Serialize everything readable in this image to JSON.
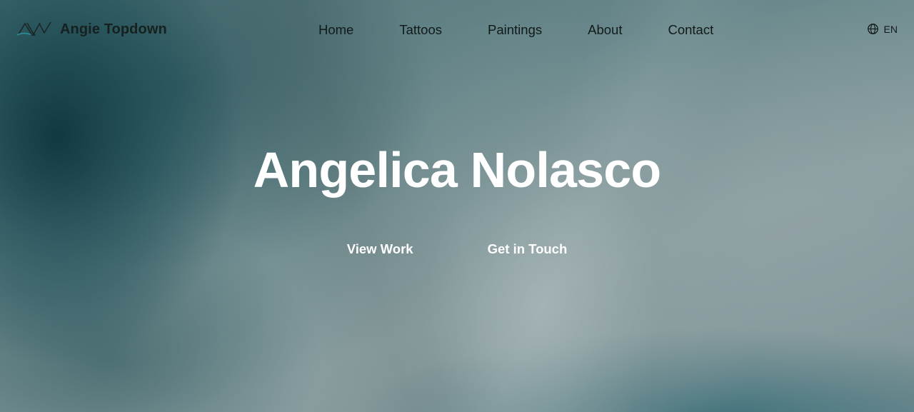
{
  "brand": {
    "name": "Angie Topdown",
    "logo_icon": "mountain-signature-logo"
  },
  "nav": {
    "items": [
      {
        "label": "Home"
      },
      {
        "label": "Tattoos"
      },
      {
        "label": "Paintings"
      },
      {
        "label": "About"
      },
      {
        "label": "Contact"
      }
    ]
  },
  "language": {
    "icon": "globe-icon",
    "label": "EN"
  },
  "hero": {
    "title": "Angelica Nolasco",
    "primary_action": "View Work",
    "secondary_action": "Get in Touch"
  },
  "colors": {
    "text_dark": "#111a19",
    "text_light": "#ffffff",
    "logo_accent": "#2a8c99"
  }
}
